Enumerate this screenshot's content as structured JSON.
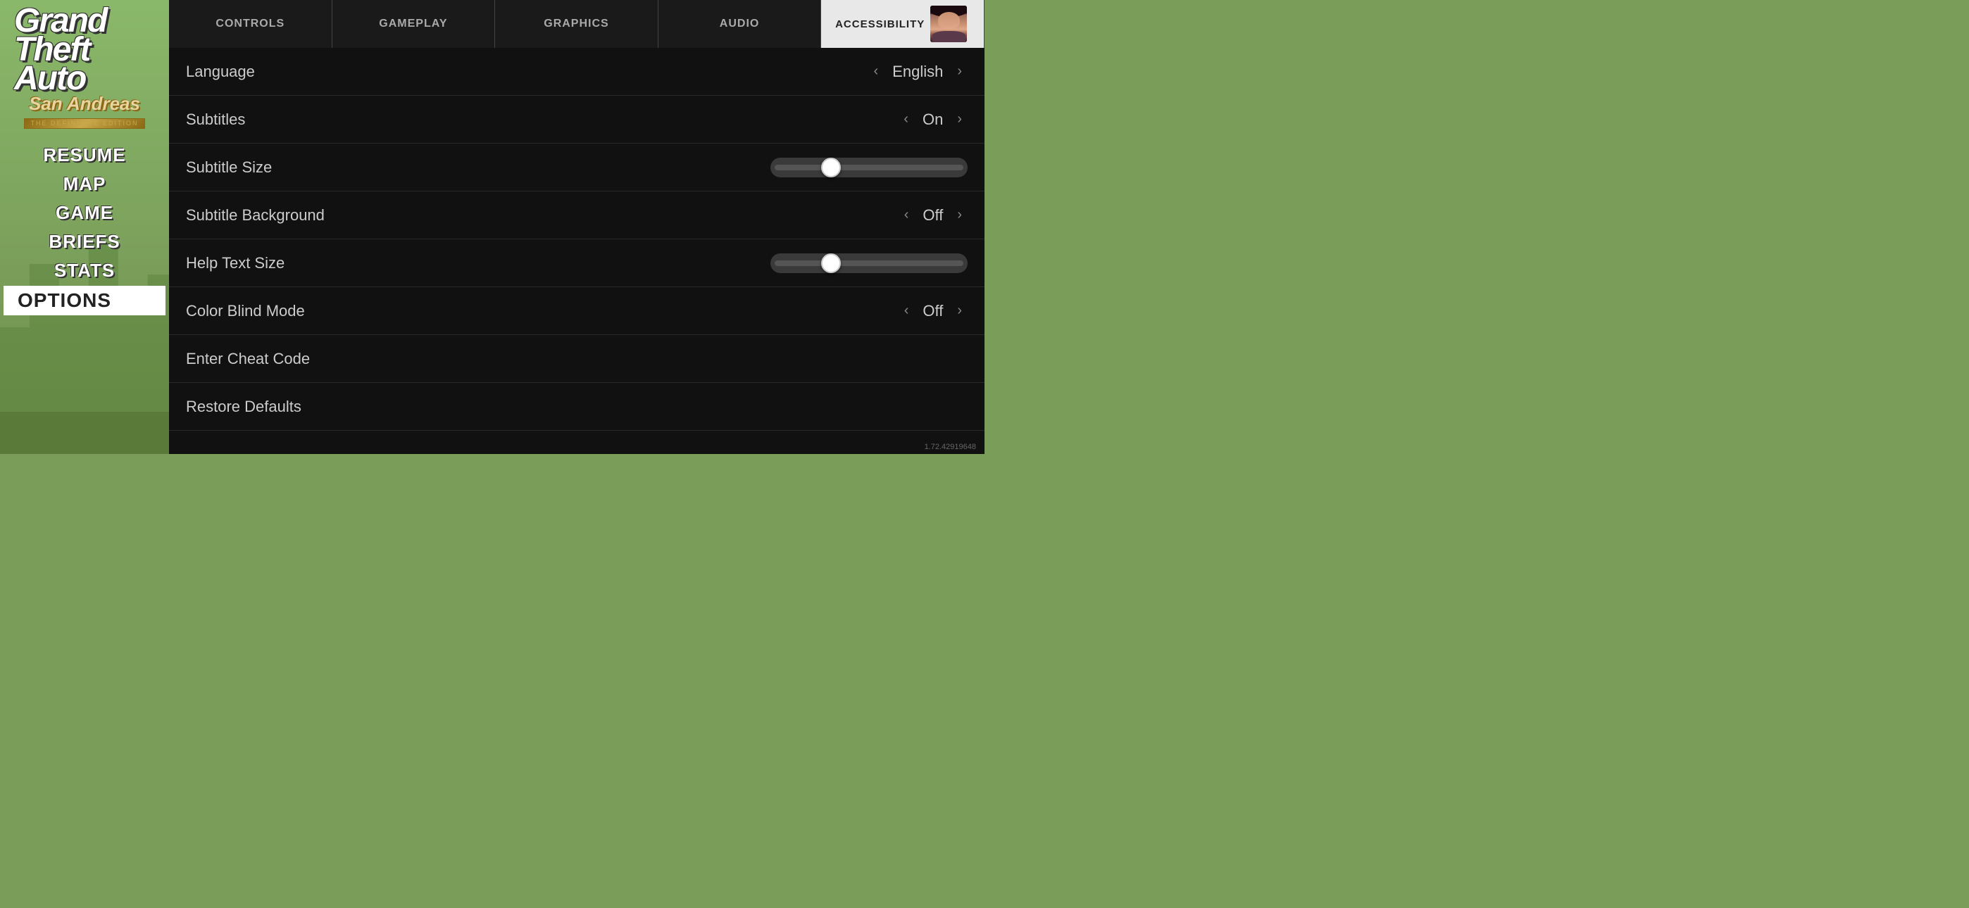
{
  "background": {
    "color": "#7a9e5a"
  },
  "logo": {
    "grand": "Grand",
    "theft": "Theft",
    "auto": "Auto",
    "san_andreas": "San Andreas",
    "edition": "THE DEFINITIVE EDITION"
  },
  "menu": {
    "items": [
      {
        "label": "RESUME",
        "active": false
      },
      {
        "label": "MAP",
        "active": false
      },
      {
        "label": "GAME",
        "active": false
      },
      {
        "label": "BRIEFS",
        "active": false
      },
      {
        "label": "STATS",
        "active": false
      },
      {
        "label": "OPTIONS",
        "active": true
      }
    ]
  },
  "tabs": [
    {
      "label": "CONTROLS",
      "active": false
    },
    {
      "label": "GAMEPLAY",
      "active": false
    },
    {
      "label": "GRAPHICS",
      "active": false
    },
    {
      "label": "AUDIO",
      "active": false
    },
    {
      "label": "ACCESSIBILITY",
      "active": true
    }
  ],
  "settings": [
    {
      "id": "language",
      "label": "Language",
      "type": "select",
      "value": "English"
    },
    {
      "id": "subtitles",
      "label": "Subtitles",
      "type": "select",
      "value": "On"
    },
    {
      "id": "subtitle-size",
      "label": "Subtitle Size",
      "type": "slider",
      "value": 0.3
    },
    {
      "id": "subtitle-background",
      "label": "Subtitle Background",
      "type": "select",
      "value": "Off"
    },
    {
      "id": "help-text-size",
      "label": "Help Text Size",
      "type": "slider",
      "value": 0.3
    },
    {
      "id": "color-blind-mode",
      "label": "Color Blind Mode",
      "type": "select",
      "value": "Off"
    },
    {
      "id": "enter-cheat-code",
      "label": "Enter Cheat Code",
      "type": "action",
      "value": ""
    },
    {
      "id": "restore-defaults",
      "label": "Restore Defaults",
      "type": "action",
      "value": ""
    }
  ],
  "version": "1.72.42919648"
}
